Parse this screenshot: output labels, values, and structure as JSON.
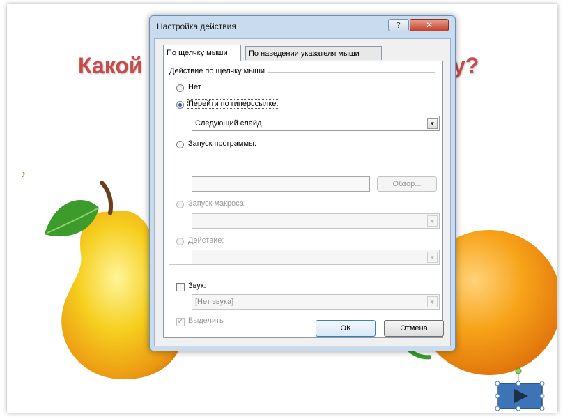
{
  "slide": {
    "title_left": "Какой",
    "title_right": "у?",
    "sound_icon": "sound-icon",
    "colors": {
      "title": "#c94a4a",
      "pear": "#f4c21d",
      "orange": "#f29a12",
      "leaf": "#3d9b2c",
      "action_button": "#3d73b7"
    }
  },
  "dialog": {
    "title": "Настройка действия",
    "help_label": "?",
    "close_label": "✕",
    "tabs": [
      {
        "label": "По щелчку мыши",
        "active": true
      },
      {
        "label": "По наведении указателя мыши",
        "active": false
      }
    ],
    "group_title": "Действие по щелчку мыши",
    "options": {
      "none": "Нет",
      "hyperlink": "Перейти по гиперссылке:",
      "hyperlink_value": "Следующий слайд",
      "program": "Запуск программы:",
      "browse": "Обзор...",
      "macro": "Запуск макроса:",
      "action": "Действие:"
    },
    "sound": {
      "label": "Звук:",
      "value": "[Нет звука]"
    },
    "highlight": {
      "label": "Выделить",
      "mark": "✓"
    },
    "ok": "ОК",
    "cancel": "Отмена"
  }
}
